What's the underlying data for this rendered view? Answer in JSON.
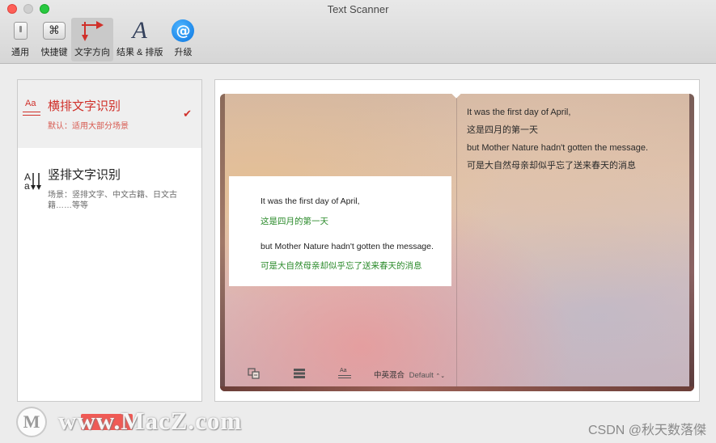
{
  "window": {
    "title": "Text Scanner"
  },
  "toolbar": {
    "items": [
      {
        "label": "通用",
        "icon": "general-switch-icon"
      },
      {
        "label": "快捷键",
        "icon": "command-key-icon",
        "glyph": "⌘"
      },
      {
        "label": "文字方向",
        "icon": "text-direction-arrows-icon",
        "active": true
      },
      {
        "label": "结果 & 排版",
        "icon": "serif-a-icon",
        "glyph": "A"
      },
      {
        "label": "升级",
        "icon": "upgrade-at-icon",
        "glyph": "@"
      }
    ]
  },
  "options": [
    {
      "title": "横排文字识别",
      "description": "默认：适用大部分场景",
      "icon_text": "Aa",
      "selected": true,
      "check": "✔"
    },
    {
      "title": "竖排文字识别",
      "description": "场景：竖排文字、中文古籍、日文古籍……等等",
      "icon_text": "A",
      "icon_text_2": "a",
      "selected": false
    }
  ],
  "preview": {
    "right_lines": [
      "It was the first day of April,",
      "这是四月的第一天",
      "but Mother Nature hadn't gotten the message.",
      "可是大自然母亲却似乎忘了送来春天的消息"
    ],
    "card_lines": [
      {
        "text": "It was the first day of April,",
        "lang": "en"
      },
      {
        "text": "这是四月的第一天",
        "lang": "zh"
      },
      {
        "text": "but Mother Nature hadn't gotten the message.",
        "lang": "en"
      },
      {
        "text": "可是大自然母亲却似乎忘了送来春天的消息",
        "lang": "zh"
      }
    ],
    "bottom_bar": {
      "icons": [
        "translate-icon",
        "list-icon",
        "text-style-icon"
      ],
      "mode_label": "中英混合",
      "mode_value": "Default",
      "mode_chevron": "⌃⌄",
      "text_style_icon_text": "Aa"
    }
  },
  "colors": {
    "accent_red": "#d0302a",
    "translation_green": "#2a8a2a",
    "upgrade_blue": "#0a74e0"
  },
  "watermarks": {
    "left_logo_glyph": "M",
    "left_text": "www.MacZ.com",
    "right_text": "CSDN @秋天数落傑"
  }
}
